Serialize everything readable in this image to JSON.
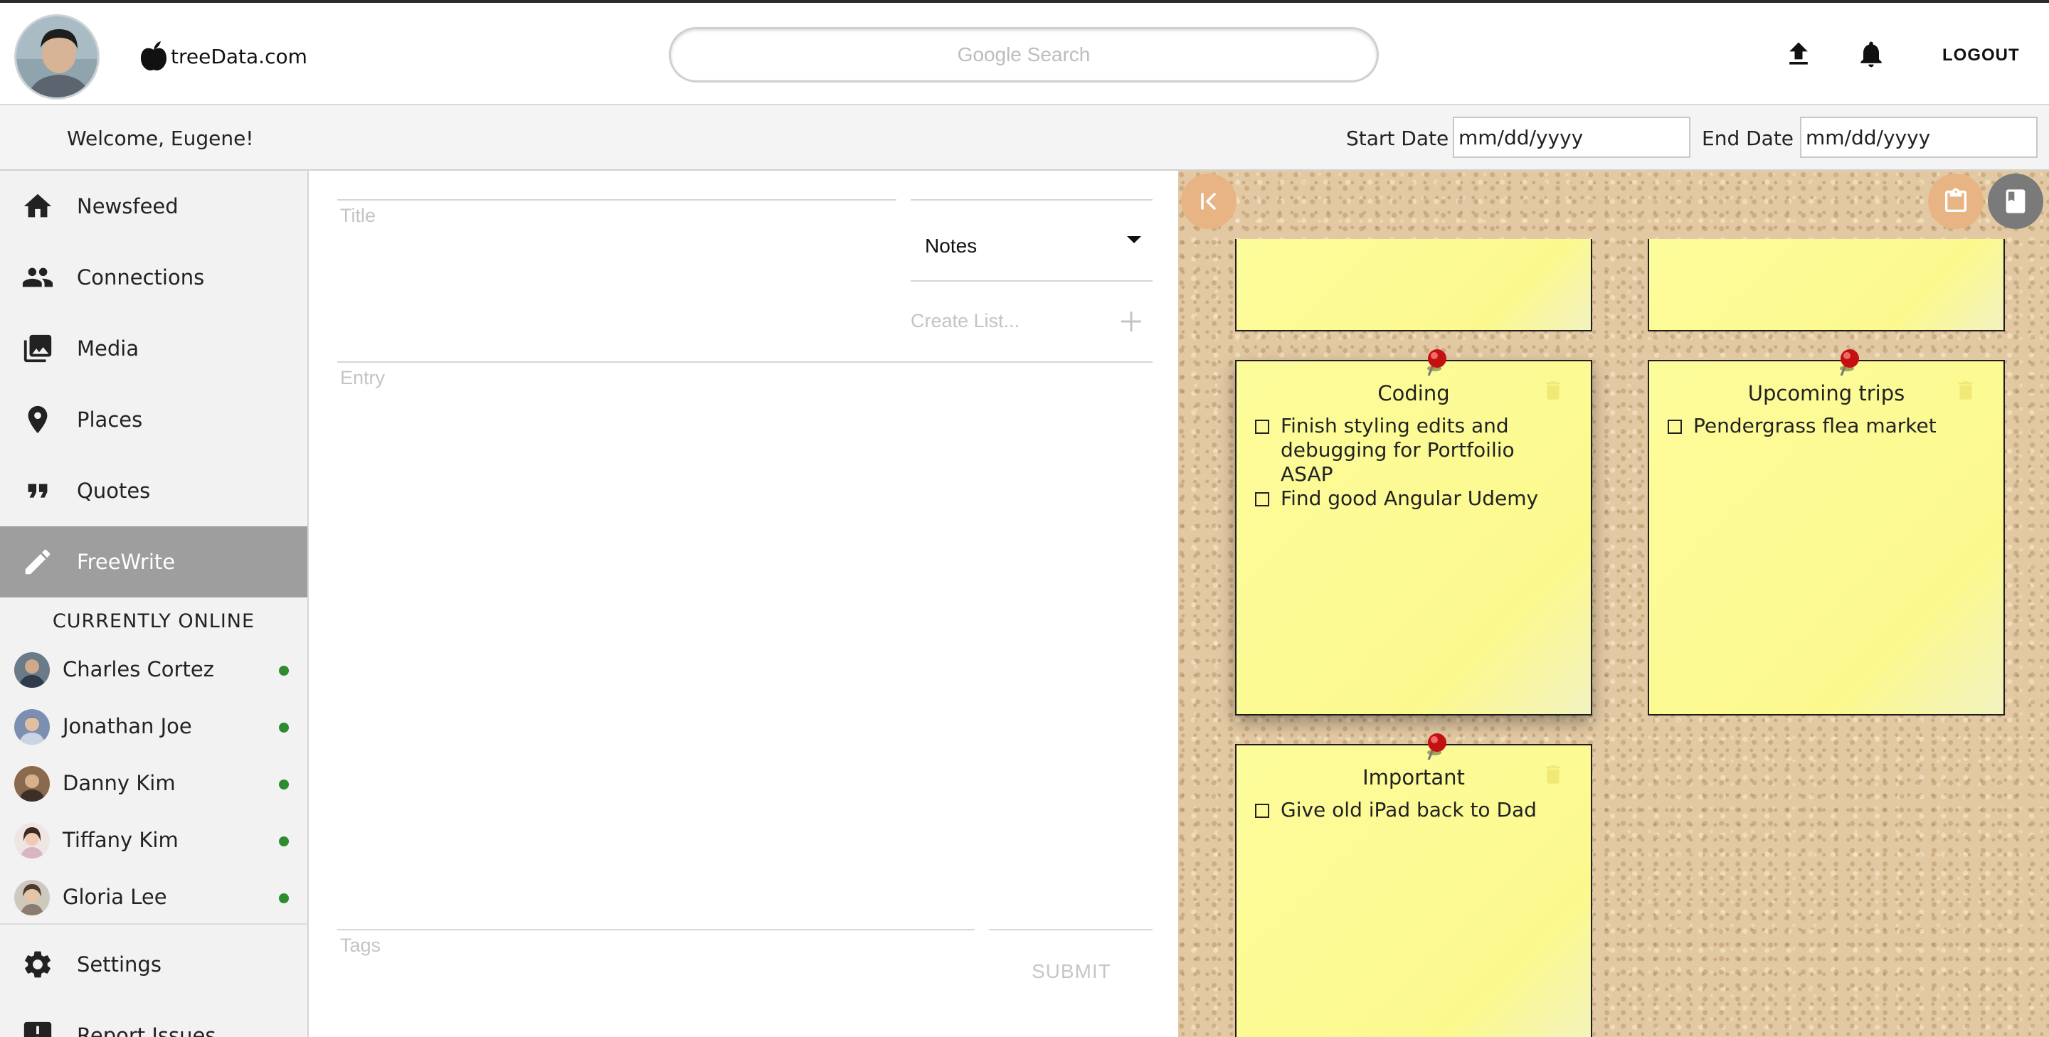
{
  "header": {
    "logo_text": "treeData.com",
    "search_placeholder": "Google Search",
    "logout_label": "LOGOUT"
  },
  "subheader": {
    "welcome": "Welcome, Eugene!",
    "start_label": "Start Date",
    "start_value": "mm/dd/yyyy",
    "end_label": "End Date",
    "end_value": "mm/dd/yyyy"
  },
  "sidebar": {
    "items": [
      {
        "label": "Newsfeed",
        "icon": "home-icon"
      },
      {
        "label": "Connections",
        "icon": "people-icon"
      },
      {
        "label": "Media",
        "icon": "photo-library-icon"
      },
      {
        "label": "Places",
        "icon": "location-pin-icon"
      },
      {
        "label": "Quotes",
        "icon": "quote-icon"
      },
      {
        "label": "FreeWrite",
        "icon": "pencil-icon",
        "active": true
      }
    ],
    "online_title": "CURRENTLY ONLINE",
    "online": [
      {
        "name": "Charles Cortez"
      },
      {
        "name": "Jonathan Joe"
      },
      {
        "name": "Danny Kim"
      },
      {
        "name": "Tiffany Kim"
      },
      {
        "name": "Gloria Lee"
      }
    ],
    "bottom_items": [
      {
        "label": "Settings",
        "icon": "gear-icon"
      },
      {
        "label": "Report Issues",
        "icon": "alert-icon"
      }
    ],
    "online_color": "#2e8b2e"
  },
  "editor": {
    "title_placeholder": "Title",
    "type_value": "Notes",
    "create_list_placeholder": "Create List...",
    "entry_placeholder": "Entry",
    "tags_placeholder": "Tags",
    "submit_label": "SUBMIT"
  },
  "board": {
    "accent": "#e8b483",
    "note_color": "#fdfc9b",
    "notes": [
      {
        "title": "Coding",
        "items": [
          "Finish styling edits and debugging for Portfoilio ASAP",
          "Find good Angular Udemy"
        ]
      },
      {
        "title": "Upcoming trips",
        "items": [
          "Pendergrass flea market"
        ]
      },
      {
        "title": "Important",
        "items": [
          "Give old iPad back to Dad"
        ]
      }
    ]
  }
}
